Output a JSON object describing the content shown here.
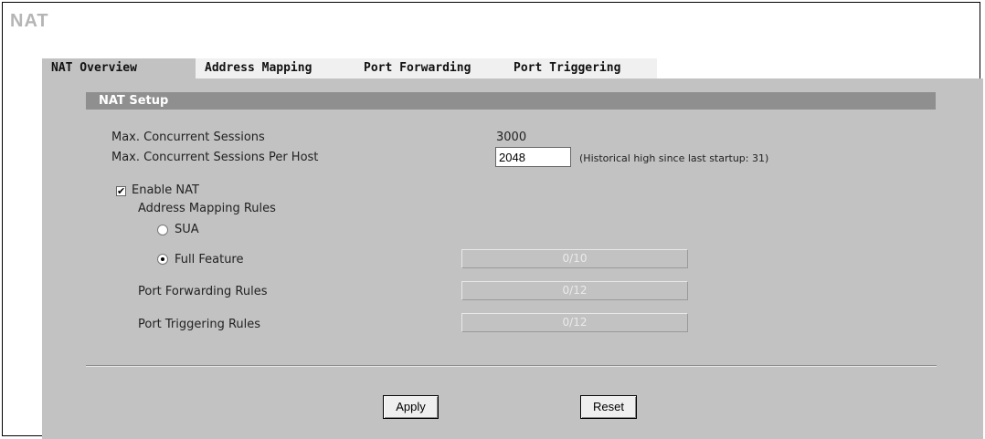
{
  "page": {
    "title": "NAT"
  },
  "tabs": [
    {
      "label": "NAT Overview"
    },
    {
      "label": "Address Mapping"
    },
    {
      "label": "Port Forwarding"
    },
    {
      "label": "Port Triggering"
    }
  ],
  "section": {
    "title": "NAT Setup"
  },
  "fields": {
    "max_sessions_label": "Max. Concurrent Sessions",
    "max_sessions_value": "3000",
    "max_sessions_per_host_label": "Max. Concurrent Sessions Per Host",
    "max_sessions_per_host_value": "2048",
    "historical_hint": "(Historical high since last startup: 31)"
  },
  "enable_nat": {
    "label": "Enable NAT",
    "checked": true,
    "check_glyph": "✔"
  },
  "address_mapping": {
    "heading": "Address Mapping Rules",
    "sua_label": "SUA",
    "full_feature_label": "Full Feature",
    "full_feature_count": "0/10",
    "selected": "full_feature"
  },
  "port_forwarding": {
    "label": "Port Forwarding Rules",
    "count": "0/12"
  },
  "port_triggering": {
    "label": "Port Triggering Rules",
    "count": "0/12"
  },
  "buttons": {
    "apply": "Apply",
    "reset": "Reset"
  },
  "colors": {
    "panel": "#c2c2c2",
    "section_bar": "#8f8f8f",
    "active_tab": "#c2c2c2",
    "inactive_tab": "#f0f0f0",
    "title": "#b5b5b5"
  }
}
